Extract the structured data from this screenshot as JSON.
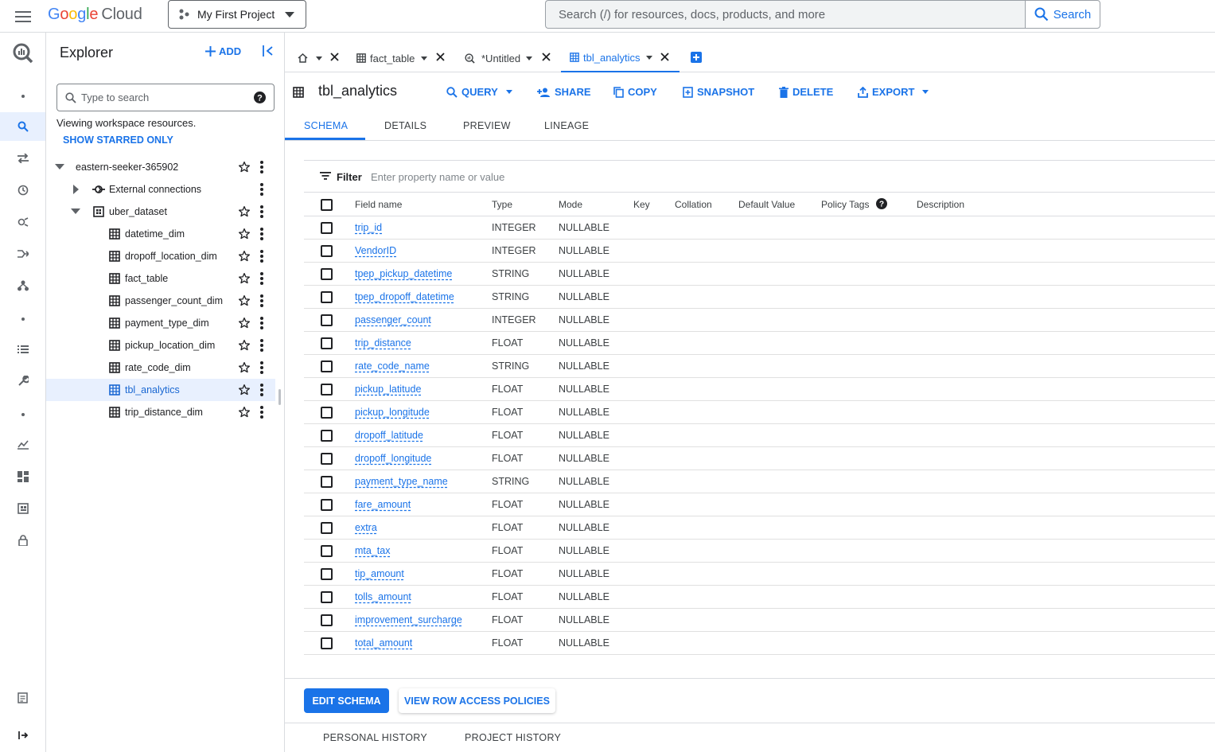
{
  "header": {
    "logo_google": [
      "G",
      "o",
      "o",
      "g",
      "l",
      "e"
    ],
    "logo_cloud": "Cloud",
    "project": "My First Project",
    "search_placeholder": "Search (/) for resources, docs, products, and more",
    "search_button": "Search"
  },
  "explorer": {
    "title": "Explorer",
    "add_label": "ADD",
    "search_placeholder": "Type to search",
    "viewing_text": "Viewing workspace resources.",
    "starred_label": "SHOW STARRED ONLY",
    "project_node": "eastern-seeker-365902",
    "external_connections": "External connections",
    "dataset": "uber_dataset",
    "tables": [
      "datetime_dim",
      "dropoff_location_dim",
      "fact_table",
      "passenger_count_dim",
      "payment_type_dim",
      "pickup_location_dim",
      "rate_code_dim",
      "tbl_analytics",
      "trip_distance_dim"
    ],
    "selected_table": "tbl_analytics"
  },
  "tabs": [
    {
      "label": "fact_table",
      "icon": "table-icon"
    },
    {
      "label": "*Untitled",
      "icon": "query-icon"
    },
    {
      "label": "tbl_analytics",
      "icon": "table-icon",
      "active": true
    }
  ],
  "table_header": {
    "name": "tbl_analytics",
    "actions": {
      "query": "QUERY",
      "share": "SHARE",
      "copy": "COPY",
      "snapshot": "SNAPSHOT",
      "delete": "DELETE",
      "export": "EXPORT"
    }
  },
  "subtabs": {
    "schema": "SCHEMA",
    "details": "DETAILS",
    "preview": "PREVIEW",
    "lineage": "LINEAGE"
  },
  "filter": {
    "label": "Filter",
    "placeholder": "Enter property name or value"
  },
  "schema": {
    "columns": {
      "field_name": "Field name",
      "type": "Type",
      "mode": "Mode",
      "key": "Key",
      "collation": "Collation",
      "default_value": "Default Value",
      "policy_tags": "Policy Tags",
      "description": "Description"
    },
    "rows": [
      {
        "name": "trip_id",
        "type": "INTEGER",
        "mode": "NULLABLE"
      },
      {
        "name": "VendorID",
        "type": "INTEGER",
        "mode": "NULLABLE"
      },
      {
        "name": "tpep_pickup_datetime",
        "type": "STRING",
        "mode": "NULLABLE"
      },
      {
        "name": "tpep_dropoff_datetime",
        "type": "STRING",
        "mode": "NULLABLE"
      },
      {
        "name": "passenger_count",
        "type": "INTEGER",
        "mode": "NULLABLE"
      },
      {
        "name": "trip_distance",
        "type": "FLOAT",
        "mode": "NULLABLE"
      },
      {
        "name": "rate_code_name",
        "type": "STRING",
        "mode": "NULLABLE"
      },
      {
        "name": "pickup_latitude",
        "type": "FLOAT",
        "mode": "NULLABLE"
      },
      {
        "name": "pickup_longitude",
        "type": "FLOAT",
        "mode": "NULLABLE"
      },
      {
        "name": "dropoff_latitude",
        "type": "FLOAT",
        "mode": "NULLABLE"
      },
      {
        "name": "dropoff_longitude",
        "type": "FLOAT",
        "mode": "NULLABLE"
      },
      {
        "name": "payment_type_name",
        "type": "STRING",
        "mode": "NULLABLE"
      },
      {
        "name": "fare_amount",
        "type": "FLOAT",
        "mode": "NULLABLE"
      },
      {
        "name": "extra",
        "type": "FLOAT",
        "mode": "NULLABLE"
      },
      {
        "name": "mta_tax",
        "type": "FLOAT",
        "mode": "NULLABLE"
      },
      {
        "name": "tip_amount",
        "type": "FLOAT",
        "mode": "NULLABLE"
      },
      {
        "name": "tolls_amount",
        "type": "FLOAT",
        "mode": "NULLABLE"
      },
      {
        "name": "improvement_surcharge",
        "type": "FLOAT",
        "mode": "NULLABLE"
      },
      {
        "name": "total_amount",
        "type": "FLOAT",
        "mode": "NULLABLE"
      }
    ]
  },
  "buttons": {
    "edit_schema": "EDIT SCHEMA",
    "view_row_access": "VIEW ROW ACCESS POLICIES"
  },
  "history": {
    "personal": "PERSONAL HISTORY",
    "project": "PROJECT HISTORY"
  },
  "colors": {
    "accent": "#1a73e8",
    "selected_bg": "#e8f0fe",
    "border": "#dadce0"
  }
}
